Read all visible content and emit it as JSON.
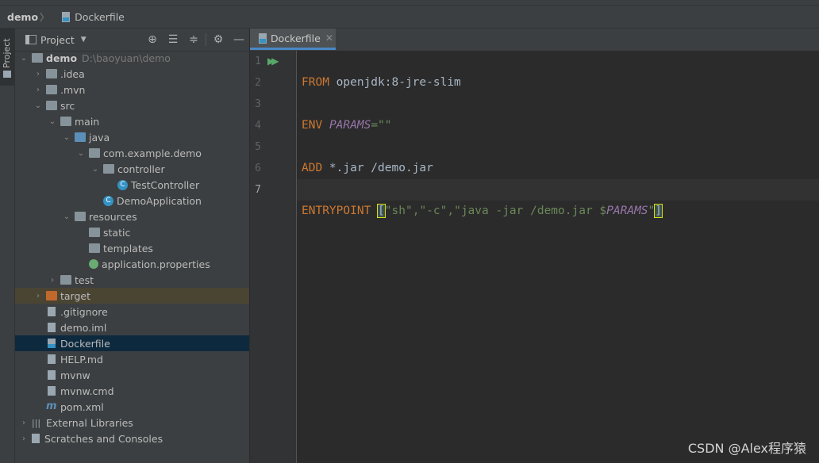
{
  "breadcrumb": {
    "project": "demo",
    "file": "Dockerfile"
  },
  "tool_stripe": {
    "project_tab": "Project"
  },
  "project_panel": {
    "title": "Project",
    "toolbar_icons": [
      "locate-icon",
      "expand-all-icon",
      "collapse-all-icon",
      "gear-icon",
      "hide-icon"
    ],
    "tree": [
      {
        "label": "demo",
        "path": "D:\\baoyuan\\demo"
      },
      {
        "label": ".idea"
      },
      {
        "label": ".mvn"
      },
      {
        "label": "src"
      },
      {
        "label": "main"
      },
      {
        "label": "java"
      },
      {
        "label": "com.example.demo"
      },
      {
        "label": "controller"
      },
      {
        "label": "TestController"
      },
      {
        "label": "DemoApplication"
      },
      {
        "label": "resources"
      },
      {
        "label": "static"
      },
      {
        "label": "templates"
      },
      {
        "label": "application.properties"
      },
      {
        "label": "test"
      },
      {
        "label": "target"
      },
      {
        "label": ".gitignore"
      },
      {
        "label": "demo.iml"
      },
      {
        "label": "Dockerfile"
      },
      {
        "label": "HELP.md"
      },
      {
        "label": "mvnw"
      },
      {
        "label": "mvnw.cmd"
      },
      {
        "label": "pom.xml"
      },
      {
        "label": "External Libraries"
      },
      {
        "label": "Scratches and Consoles"
      }
    ]
  },
  "editor": {
    "tab_label": "Dockerfile",
    "line_numbers": [
      "1",
      "2",
      "3",
      "4",
      "5",
      "6",
      "7"
    ],
    "lines": {
      "l1": {
        "kw": "FROM",
        "rest": " openjdk:8-jre-slim"
      },
      "l3": {
        "kw": "ENV",
        "var": "PARAMS",
        "rest": "=\"\""
      },
      "l5": {
        "kw": "ADD",
        "rest": " *.jar /demo.jar"
      },
      "l7": {
        "kw": "ENTRYPOINT",
        "open": "[",
        "s1": "\"sh\"",
        "c1": ",",
        "s2": "\"-c\"",
        "c2": ",",
        "s3": "\"java -jar /demo.jar $",
        "var": "PARAMS",
        "s4": "\"",
        "close": "]"
      }
    }
  },
  "watermark": "CSDN @Alex程序猿",
  "colors": {
    "keyword": "#cc7832",
    "string": "#6a8759",
    "variable": "#9876aa",
    "selection": "#0d293e",
    "tab_underline": "#4a88c7"
  }
}
